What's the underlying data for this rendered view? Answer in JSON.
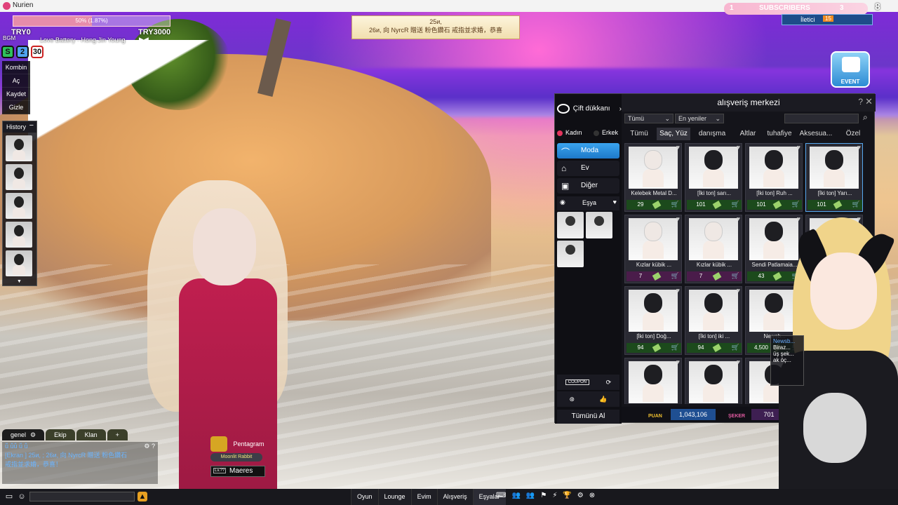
{
  "window": {
    "title": "Nurien"
  },
  "hud": {
    "progress_text": "50% (1.87%)",
    "progress_fraction": 0.5,
    "try_left": "TRY0",
    "try_right": "TRY3000",
    "bgm_label": "BGM",
    "song": "Love Battery - Hong Jin Young",
    "play_controls": "▶◀",
    "badges": [
      "S",
      "2",
      "30"
    ]
  },
  "side_menu": [
    "Kombin",
    "Aç",
    "Kaydet",
    "Gizle"
  ],
  "history": {
    "title": "History",
    "minimize": "−",
    "scroll": "▼",
    "count": 5
  },
  "announcement": {
    "line1": "25и,",
    "line2": "26и, 向 NyrcR 贈送 粉色鑽石 戒指並求婚，恭喜"
  },
  "top_right": {
    "subs_left": "1",
    "subs_label": "SUBSCRIBERS",
    "subs_right": "3",
    "corner_digit": "8",
    "message_label": "İletici",
    "message_count": "15",
    "event_label": "EVENT"
  },
  "shop": {
    "title": "alışveriş merkezi",
    "help": "?",
    "close": "✕",
    "couple_shop": "Çift dükkanı",
    "gender": {
      "female": "Kadın",
      "male": "Erkek"
    },
    "categories": [
      {
        "label": "Moda",
        "icon": "hanger-icon",
        "active": true
      },
      {
        "label": "Ev",
        "icon": "house-icon",
        "active": false
      },
      {
        "label": "Diğer",
        "icon": "gift-icon",
        "active": false
      }
    ],
    "item_label": "Eşya",
    "filters": {
      "type": "Tümü",
      "sort": "En yeniler",
      "search_placeholder": ""
    },
    "tabs": [
      "Tümü",
      "Saç, Yüz",
      "danışma",
      "Altlar",
      "tuhafiye",
      "Aksesua...",
      "Özel"
    ],
    "active_tab": 1,
    "items": [
      {
        "name": "Kelebek Metal D...",
        "price": "29",
        "hair": "bald",
        "currency": "green"
      },
      {
        "name": "[İki ton] sarı...",
        "price": "101",
        "hair": "long",
        "currency": "green"
      },
      {
        "name": "[İki ton] Ruh ...",
        "price": "101",
        "hair": "long",
        "currency": "green"
      },
      {
        "name": "[İki ton] Yarı...",
        "price": "101",
        "hair": "long",
        "currency": "green",
        "selected": true
      },
      {
        "name": "Kızlar kübik ...",
        "price": "7",
        "hair": "bald",
        "currency": "purple"
      },
      {
        "name": "Kızlar kübik ...",
        "price": "7",
        "hair": "bald",
        "currency": "purple"
      },
      {
        "name": "Sendi Patlamaia...",
        "price": "43",
        "hair": "short",
        "currency": "green"
      },
      {
        "name": "",
        "price": "",
        "hair": "long",
        "currency": "green"
      },
      {
        "name": "[İki ton] Doğ...",
        "price": "94",
        "hair": "long",
        "currency": "green"
      },
      {
        "name": "[İki ton] iki ...",
        "price": "94",
        "hair": "long",
        "currency": "green"
      },
      {
        "name": "Newsb...",
        "price": "4,500",
        "hair": "short",
        "currency": "green"
      },
      {
        "name": "",
        "price": "",
        "hair": "long",
        "currency": "green"
      },
      {
        "name": "",
        "price": "",
        "hair": "long",
        "currency": "green"
      },
      {
        "name": "",
        "price": "",
        "hair": "long",
        "currency": "green"
      },
      {
        "name": "",
        "price": "",
        "hair": "short",
        "currency": "green"
      }
    ],
    "coupon_label": "COUPON",
    "buy_all": "Tümünü Al",
    "puan_label": "PUAN",
    "puan_value": "1,043,106",
    "seker_label": "ŞEKER",
    "seker_value": "701"
  },
  "tooltip": {
    "title": "Newsb...",
    "line1": "Biraz...",
    "line2": "üş şek...",
    "line3": "ak öç..."
  },
  "chat": {
    "tabs": [
      "genel",
      "Ekip",
      "Klan",
      "+"
    ],
    "gear": "⚙",
    "controls": "⚙ ?",
    "lines": [
      "ṻ ṻṻ ṻ ṻ",
      "[Ekran ] 25и, ; 26и, 向 NyrcR 贈送 粉色鑽石",
      "戒指並求婚，恭喜！"
    ]
  },
  "nameplate": {
    "guild": "Pentagram",
    "title": "Moonlit Rabbit",
    "level": "Lv.??",
    "name": "Maeres"
  },
  "bottom_menu": {
    "buttons": [
      "Oyun",
      "Lounge",
      "Evim",
      "Alışveriş",
      "Eşyalar"
    ],
    "active": 4,
    "tools": [
      "⌨",
      "👥",
      "👥",
      "⚑",
      "⚡",
      "🏆",
      "⚙",
      "⊗"
    ]
  }
}
